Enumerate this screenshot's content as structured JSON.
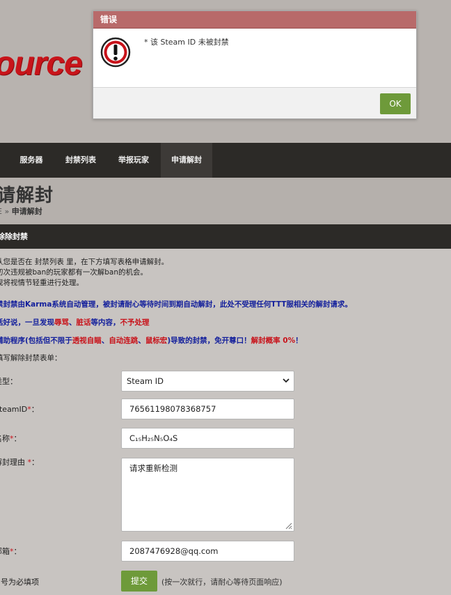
{
  "site": {
    "logo_text": "ource"
  },
  "nav": {
    "items": [
      {
        "label": "服务器"
      },
      {
        "label": "封禁列表"
      },
      {
        "label": "举报玩家"
      },
      {
        "label": "申请解封"
      }
    ]
  },
  "page": {
    "title": "请解封",
    "breadcrumb_home": "E",
    "breadcrumb_sep": "»",
    "breadcrumb_current": "申请解封"
  },
  "section": {
    "title": "除除封禁"
  },
  "intro": {
    "line1": "认您是否在 封禁列表 里，在下方填写表格申请解封。",
    "line2": "初次违规被ban的玩家都有一次解ban的机会。",
    "line3": "规将视情节轻重进行处理。"
  },
  "notices": {
    "karma": "禁封禁由Karma系统自动管理，被封请耐心等待时间到期自动解封，此处不受理任何TTT服相关的解封请求。",
    "warn_prefix": "话好说，一旦发现",
    "warn_term1": "辱骂",
    "warn_sep": "、",
    "warn_term2": "脏话",
    "warn_mid": "等内容，",
    "warn_end": "不予处理",
    "cheat_prefix": "辅助程序(包括但不限于",
    "cheat_term1": "透视自瞄",
    "cheat_sep1": "、",
    "cheat_term2": "自动连跳",
    "cheat_sep2": "、",
    "cheat_term3": "鼠标宏",
    "cheat_mid": ")导致的封禁，免开尊口！",
    "cheat_end": "解封概率 0%",
    "cheat_bang": "！"
  },
  "form": {
    "intro": "填写解除封禁表单：",
    "type_label": "类型：",
    "type_value": "Steam ID",
    "steamid_label": "SteamID",
    "steamid_value": "76561198078368757",
    "name_label": "名称",
    "name_value": "C₁₅H₂₅N₅O₄S",
    "reason_label": "解封理由 ",
    "reason_value": "请求重新检测",
    "email_label": "邮箱",
    "email_value": "2087476928@qq.com",
    "required_mark": "*",
    "colon": "：",
    "required_note": "号为必填项",
    "submit_label": "提交",
    "submit_hint": "(按一次就行，请耐心等待页面响应)"
  },
  "dialog": {
    "title": "错误",
    "message": "* 该 Steam ID 未被封禁",
    "ok_label": "OK"
  },
  "colors": {
    "accent_green": "#6e9a3a",
    "dialog_header": "#b86a6a",
    "notice_blue": "#14209c",
    "notice_red": "#c8121a"
  }
}
